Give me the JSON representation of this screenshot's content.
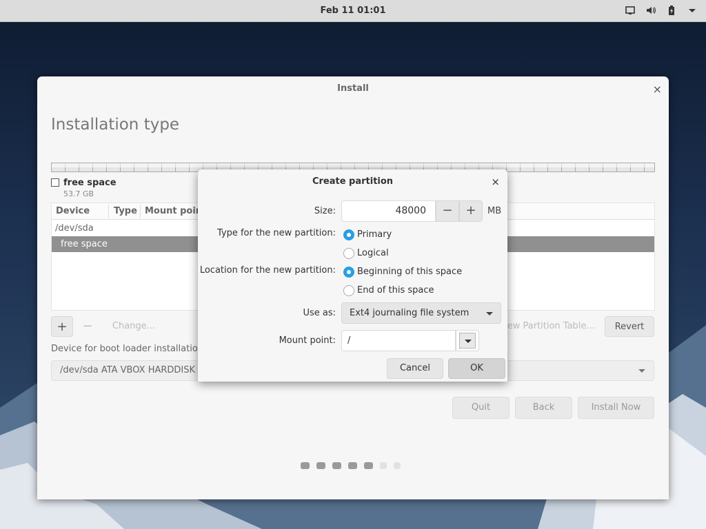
{
  "topbar": {
    "clock": "Feb 11  01:01",
    "tray_icons": [
      "display-icon",
      "volume-icon",
      "battery-icon",
      "menu-arrow-icon"
    ]
  },
  "window": {
    "title": "Install",
    "close_glyph": "×",
    "page_title": "Installation type",
    "legend": {
      "name": "free space",
      "size": "53.7 GB"
    },
    "table": {
      "headers": [
        "Device",
        "Type",
        "Mount point"
      ],
      "rows": [
        {
          "label": "/dev/sda",
          "selected": false
        },
        {
          "label": "free space",
          "selected": true
        }
      ]
    },
    "toolbar": {
      "add": "+",
      "remove": "−",
      "change": "Change...",
      "new_table": "New Partition Table...",
      "revert": "Revert"
    },
    "bootloader": {
      "label": "Device for boot loader installation:",
      "value": "/dev/sda   ATA VBOX HARDDISK (53.7 GB)"
    },
    "nav": {
      "quit": "Quit",
      "back": "Back",
      "install": "Install Now"
    },
    "progress": {
      "total": 7,
      "completed": 5
    }
  },
  "dialog": {
    "title": "Create partition",
    "close_glyph": "×",
    "size_label": "Size:",
    "size_value": "48000",
    "minus": "−",
    "plus": "+",
    "unit": "MB",
    "type_label": "Type for the new partition:",
    "type_options": [
      "Primary",
      "Logical"
    ],
    "type_selected": "Primary",
    "location_label": "Location for the new partition:",
    "location_options": [
      "Beginning of this space",
      "End of this space"
    ],
    "location_selected": "Beginning of this space",
    "use_as_label": "Use as:",
    "use_as_value": "Ext4 journaling file system",
    "mount_label": "Mount point:",
    "mount_value": "/",
    "cancel": "Cancel",
    "ok": "OK"
  },
  "colors": {
    "accent": "#2a9ee4",
    "selected_row": "#909090",
    "panel": "#dcdcdc"
  }
}
